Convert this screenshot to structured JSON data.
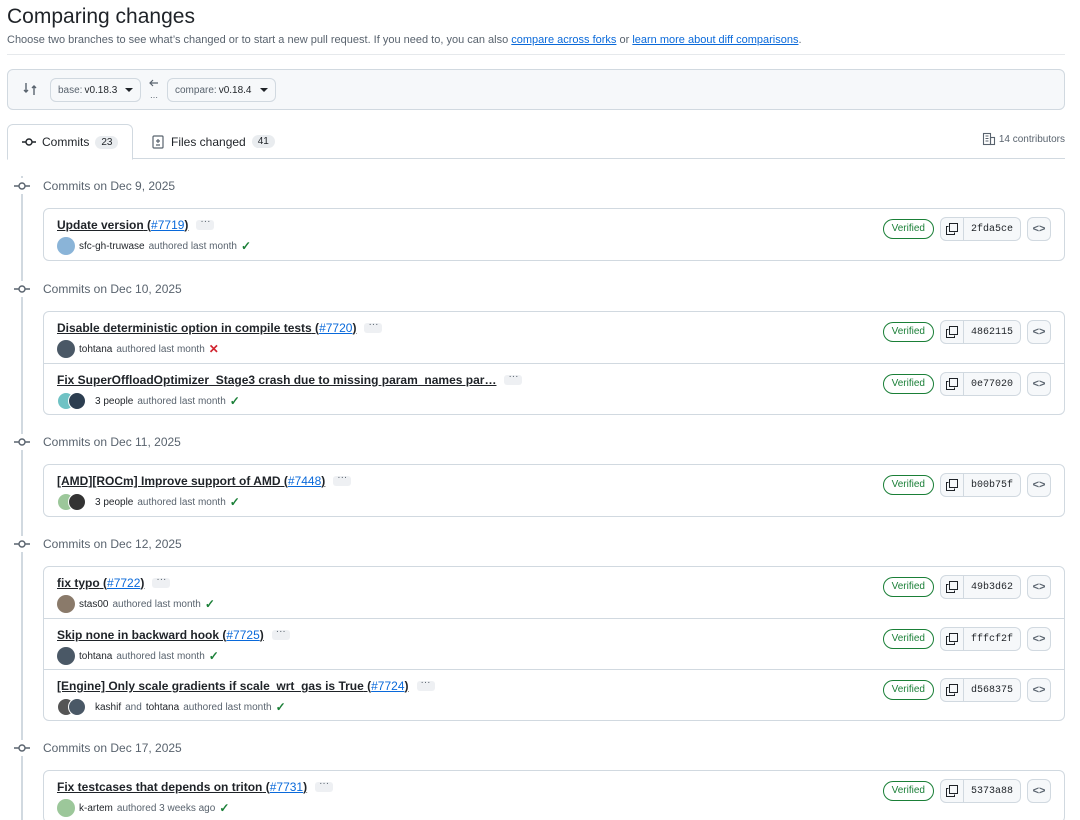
{
  "header": {
    "title": "Comparing changes",
    "subtitle_prefix": "Choose two branches to see what’s changed or to start a new pull request. If you need to, you can also ",
    "link_forks": "compare across forks",
    "subtitle_or": " or ",
    "link_learn": "learn more about diff comparisons",
    "subtitle_end": "."
  },
  "range": {
    "base_label": "base:",
    "base_value": "v0.18.3",
    "compare_label": "compare:",
    "compare_value": "v0.18.4"
  },
  "tabs": {
    "commits_label": "Commits",
    "commits_count": "23",
    "files_label": "Files changed",
    "files_count": "41",
    "contributors": "14 contributors"
  },
  "colors": {
    "link": "#0969da",
    "verified": "#1a7f37",
    "fail": "#d1242f"
  },
  "days": [
    {
      "label": "Commits on Dec 9, 2025",
      "commits": [
        {
          "title": "Update version",
          "pr": "#7719",
          "author": "sfc-gh-truwase",
          "meta": "authored last month",
          "status": "check",
          "sha": "2fda5ce",
          "verified": "Verified"
        }
      ]
    },
    {
      "label": "Commits on Dec 10, 2025",
      "commits": [
        {
          "title": "Disable deterministic option in compile tests",
          "pr": "#7720",
          "author": "tohtana",
          "meta": "authored last month",
          "status": "fail",
          "sha": "4862115",
          "verified": "Verified"
        },
        {
          "title": "Fix SuperOffloadOptimizer_Stage3 crash due to missing param_names par…",
          "pr": "",
          "author": "3 people",
          "meta": "authored last month",
          "status": "check",
          "sha": "0e77020",
          "verified": "Verified"
        }
      ]
    },
    {
      "label": "Commits on Dec 11, 2025",
      "commits": [
        {
          "title": "[AMD][ROCm] Improve support of AMD",
          "pr": "#7448",
          "author": "3 people",
          "meta": "authored last month",
          "status": "check",
          "sha": "b00b75f",
          "verified": "Verified"
        }
      ]
    },
    {
      "label": "Commits on Dec 12, 2025",
      "commits": [
        {
          "title": "fix typo",
          "pr": "#7722",
          "author": "stas00",
          "meta": "authored last month",
          "status": "check",
          "sha": "49b3d62",
          "verified": "Verified"
        },
        {
          "title": "Skip none in backward hook",
          "pr": "#7725",
          "author": "tohtana",
          "meta": "authored last month",
          "status": "check",
          "sha": "fffcf2f",
          "verified": "Verified"
        },
        {
          "title": "[Engine] Only scale gradients if scale_wrt_gas is True",
          "pr": "#7724",
          "author": "kashif",
          "and": "and",
          "author2": "tohtana",
          "meta": "authored last month",
          "status": "check",
          "sha": "d568375",
          "verified": "Verified"
        }
      ]
    },
    {
      "label": "Commits on Dec 17, 2025",
      "commits": [
        {
          "title": "Fix testcases that depends on triton",
          "pr": "#7731",
          "author": "k-artem",
          "meta": "authored 3 weeks ago",
          "status": "check",
          "sha": "5373a88",
          "verified": "Verified"
        }
      ]
    }
  ]
}
